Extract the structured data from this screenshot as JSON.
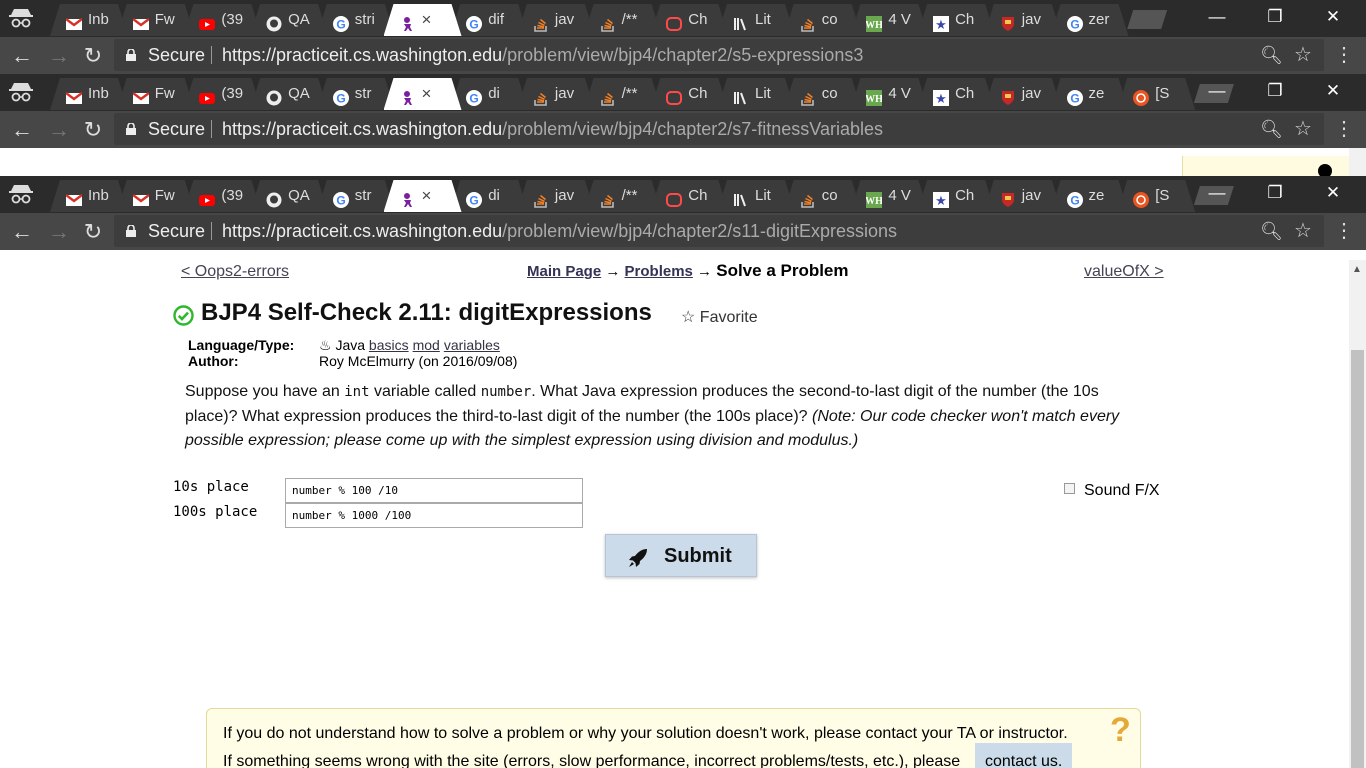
{
  "windows": [
    {
      "tabs": [
        {
          "title": "Inb",
          "icon": "gmail-icon",
          "color": "#d93025"
        },
        {
          "title": "Fw",
          "icon": "gmail-icon",
          "color": "#d93025"
        },
        {
          "title": "(39",
          "icon": "youtube-icon",
          "color": "#ff0000"
        },
        {
          "title": "QA",
          "icon": "github-icon",
          "color": "#eeeeee"
        },
        {
          "title": "stri",
          "icon": "google-icon",
          "color": "#4285f4"
        },
        {
          "title": "",
          "icon": "practiceit-icon",
          "color": "#7b1fa2",
          "active": true
        },
        {
          "title": "dif",
          "icon": "google-icon",
          "color": "#4285f4"
        },
        {
          "title": "jav",
          "icon": "stackoverflow-icon",
          "color": "#f48024"
        },
        {
          "title": "/**",
          "icon": "stackoverflow-icon",
          "color": "#f48024"
        },
        {
          "title": "Ch",
          "icon": "chegg-icon",
          "color": "#ff4a4a"
        },
        {
          "title": "Lit",
          "icon": "library-icon",
          "color": "#eeeeee"
        },
        {
          "title": "co",
          "icon": "stackoverflow-icon",
          "color": "#f48024"
        },
        {
          "title": "4 V",
          "icon": "wh-icon",
          "color": "#6aa84f"
        },
        {
          "title": "Ch",
          "icon": "shield-star-icon",
          "color": "#3949ab"
        },
        {
          "title": "jav",
          "icon": "crest-icon",
          "color": "#c62828"
        },
        {
          "title": "zer",
          "icon": "google-icon",
          "color": "#4285f4"
        }
      ],
      "secure_label": "Secure",
      "url_host": "https://practiceit.cs.washington.edu",
      "url_path": "/problem/view/bjp4/chapter2/s5-expressions3"
    },
    {
      "tabs": [
        {
          "title": "Inb",
          "icon": "gmail-icon",
          "color": "#d93025"
        },
        {
          "title": "Fw",
          "icon": "gmail-icon",
          "color": "#d93025"
        },
        {
          "title": "(39",
          "icon": "youtube-icon",
          "color": "#ff0000"
        },
        {
          "title": "QA",
          "icon": "github-icon",
          "color": "#eeeeee"
        },
        {
          "title": "str",
          "icon": "google-icon",
          "color": "#4285f4"
        },
        {
          "title": "",
          "icon": "practiceit-icon",
          "color": "#7b1fa2",
          "active": true
        },
        {
          "title": "di",
          "icon": "google-icon",
          "color": "#4285f4"
        },
        {
          "title": "jav",
          "icon": "stackoverflow-icon",
          "color": "#f48024"
        },
        {
          "title": "/**",
          "icon": "stackoverflow-icon",
          "color": "#f48024"
        },
        {
          "title": "Ch",
          "icon": "chegg-icon",
          "color": "#ff4a4a"
        },
        {
          "title": "Lit",
          "icon": "library-icon",
          "color": "#eeeeee"
        },
        {
          "title": "co",
          "icon": "stackoverflow-icon",
          "color": "#f48024"
        },
        {
          "title": "4 V",
          "icon": "wh-icon",
          "color": "#6aa84f"
        },
        {
          "title": "Ch",
          "icon": "shield-star-icon",
          "color": "#3949ab"
        },
        {
          "title": "jav",
          "icon": "crest-icon",
          "color": "#c62828"
        },
        {
          "title": "ze",
          "icon": "google-icon",
          "color": "#4285f4"
        },
        {
          "title": "[S",
          "icon": "ubuntu-icon",
          "color": "#e95420"
        }
      ],
      "secure_label": "Secure",
      "url_host": "https://practiceit.cs.washington.edu",
      "url_path": "/problem/view/bjp4/chapter2/s7-fitnessVariables"
    },
    {
      "tabs": [
        {
          "title": "Inb",
          "icon": "gmail-icon",
          "color": "#d93025"
        },
        {
          "title": "Fw",
          "icon": "gmail-icon",
          "color": "#d93025"
        },
        {
          "title": "(39",
          "icon": "youtube-icon",
          "color": "#ff0000"
        },
        {
          "title": "QA",
          "icon": "github-icon",
          "color": "#eeeeee"
        },
        {
          "title": "str",
          "icon": "google-icon",
          "color": "#4285f4"
        },
        {
          "title": "",
          "icon": "practiceit-icon",
          "color": "#7b1fa2",
          "active": true
        },
        {
          "title": "di",
          "icon": "google-icon",
          "color": "#4285f4"
        },
        {
          "title": "jav",
          "icon": "stackoverflow-icon",
          "color": "#f48024"
        },
        {
          "title": "/**",
          "icon": "stackoverflow-icon",
          "color": "#f48024"
        },
        {
          "title": "Ch",
          "icon": "chegg-icon",
          "color": "#ff4a4a"
        },
        {
          "title": "Lit",
          "icon": "library-icon",
          "color": "#eeeeee"
        },
        {
          "title": "co",
          "icon": "stackoverflow-icon",
          "color": "#f48024"
        },
        {
          "title": "4 V",
          "icon": "wh-icon",
          "color": "#6aa84f"
        },
        {
          "title": "Ch",
          "icon": "shield-star-icon",
          "color": "#3949ab"
        },
        {
          "title": "jav",
          "icon": "crest-icon",
          "color": "#c62828"
        },
        {
          "title": "ze",
          "icon": "google-icon",
          "color": "#4285f4"
        },
        {
          "title": "[S",
          "icon": "ubuntu-icon",
          "color": "#e95420"
        }
      ],
      "secure_label": "Secure",
      "url_host": "https://practiceit.cs.washington.edu",
      "url_path": "/problem/view/bjp4/chapter2/s11-digitExpressions"
    }
  ],
  "page": {
    "prev_link": "< Oops2-errors",
    "next_link": "valueOfX >",
    "crumb_main": "Main Page",
    "crumb_arrow": " → ",
    "crumb_problems": "Problems",
    "crumb_current": "Solve a Problem",
    "title": "BJP4 Self-Check 2.11: digitExpressions",
    "favorite_label": "☆ Favorite",
    "meta": {
      "lang_key": "Language/Type:",
      "lang_java": "Java",
      "tags": [
        "basics",
        "mod",
        "variables"
      ],
      "author_key": "Author:",
      "author_val": "Roy McElmurry (on 2016/09/08)"
    },
    "desc": {
      "p1": "Suppose you have an ",
      "code1": "int",
      "p2": " variable called ",
      "code2": "number",
      "p3": ". What Java expression produces the second-to-last digit of the number (the 10s place)? What expression produces the third-to-last digit of the number (the 100s place)? ",
      "note": "(Note: Our code checker won't match every possible expression; please come up with the simplest expression using division and modulus.)"
    },
    "fields": [
      {
        "label": "10s place",
        "value": "number % 100 /10"
      },
      {
        "label": "100s place",
        "value": "number % 1000 /100"
      }
    ],
    "sound_label": "Sound F/X",
    "submit_label": "Submit",
    "help_line1": "If you do not understand how to solve a problem or why your solution doesn't work, please contact your TA or instructor.",
    "help_line2": "If something seems wrong with the site (errors, slow performance, incorrect problems/tests, etc.), please",
    "contact_label": "contact us."
  },
  "colors": {
    "check_green": "#2eb82e",
    "submit_bg": "#ccdbe9",
    "help_bg": "#fffde6"
  }
}
